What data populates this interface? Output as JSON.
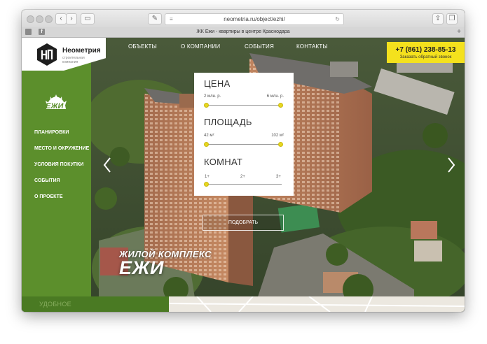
{
  "browser": {
    "url": "neometria.ru/object/ezhi/",
    "tab_title": "ЖК Ежи - квартиры в центре Краснодара"
  },
  "logo": {
    "name": "Неометрия",
    "subtitle": "строительная компания"
  },
  "badge": {
    "text": "ЕЖИ"
  },
  "sidebar": {
    "items": [
      {
        "label": "ПЛАНИРОВКИ"
      },
      {
        "label": "МЕСТО И ОКРУЖЕНИЕ"
      },
      {
        "label": "УСЛОВИЯ ПОКУПКИ"
      },
      {
        "label": "СОБЫТИЯ"
      },
      {
        "label": "О ПРОЕКТЕ"
      }
    ]
  },
  "topnav": {
    "items": [
      {
        "label": "ОБЪЕКТЫ"
      },
      {
        "label": "О КОМПАНИИ"
      },
      {
        "label": "СОБЫТИЯ"
      },
      {
        "label": "КОНТАКТЫ"
      }
    ]
  },
  "phone": {
    "number": "+7 (861) 238-85-13",
    "callback": "Заказать обратный звонок"
  },
  "filter": {
    "price": {
      "title": "ЦЕНА",
      "min": "2 млн. р.",
      "max": "6 млн. р.",
      "selected_min": 0,
      "selected_max": 1
    },
    "area": {
      "title": "ПЛОЩАДЬ",
      "min": "42 м²",
      "max": "102 м²",
      "selected_min": 0,
      "selected_max": 1
    },
    "rooms": {
      "title": "КОМНАТ",
      "options": [
        "1+",
        "2+",
        "3+"
      ]
    },
    "submit_label": "ПОДОБРАТЬ"
  },
  "hero": {
    "line1": "ЖИЛОЙ КОМПЛЕКС",
    "line2": "ЕЖИ"
  },
  "bottom": {
    "label": "УДОБНОЕ"
  },
  "colors": {
    "sidebar_green": "#5c8f2c",
    "accent_yellow": "#f4e11d"
  }
}
